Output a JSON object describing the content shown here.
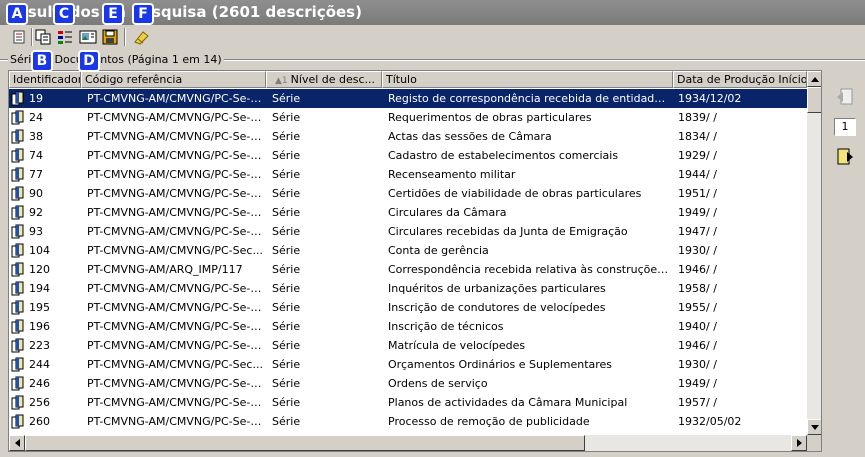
{
  "window": {
    "title": "Resultados da pesquisa (2601 descrições)"
  },
  "toolbar": {
    "markers": [
      "A",
      "B",
      "C",
      "D",
      "E",
      "F"
    ]
  },
  "group": {
    "label": "Séries / Documentos (Página 1 em 14)"
  },
  "table": {
    "columns": [
      "Identificador",
      "Código referência",
      "Nível de desc...",
      "Título",
      "Data de Produção Início"
    ],
    "sort_indicator": "▲1",
    "rows": [
      {
        "id": "19",
        "ref": "PT-CMVNG-AM/CMVNG/PC-Se-S...",
        "nivel": "Série",
        "titulo": "Registo de correspondência recebida de entidades parti...",
        "data": "1934/12/02"
      },
      {
        "id": "24",
        "ref": "PT-CMVNG-AM/CMVNG/PC-Se-S...",
        "nivel": "Série",
        "titulo": "Requerimentos de obras particulares",
        "data": "1839/  /"
      },
      {
        "id": "38",
        "ref": "PT-CMVNG-AM/CMVNG/PC-Se-S...",
        "nivel": "Série",
        "titulo": "Actas das sessões de Câmara",
        "data": "1834/  /"
      },
      {
        "id": "74",
        "ref": "PT-CMVNG-AM/CMVNG/PC-Se-S...",
        "nivel": "Série",
        "titulo": "Cadastro de estabelecimentos comerciais",
        "data": "1929/  /"
      },
      {
        "id": "77",
        "ref": "PT-CMVNG-AM/CMVNG/PC-Se-S...",
        "nivel": "Série",
        "titulo": "Recenseamento militar",
        "data": "1944/  /"
      },
      {
        "id": "90",
        "ref": "PT-CMVNG-AM/CMVNG/PC-Se-S...",
        "nivel": "Série",
        "titulo": "Certidões de viabilidade de obras particulares",
        "data": "1951/  /"
      },
      {
        "id": "92",
        "ref": "PT-CMVNG-AM/CMVNG/PC-Se-S...",
        "nivel": "Série",
        "titulo": "Circulares da Câmara",
        "data": "1949/  /"
      },
      {
        "id": "93",
        "ref": "PT-CMVNG-AM/CMVNG/PC-Se-S...",
        "nivel": "Série",
        "titulo": "Circulares recebidas da Junta de Emigração",
        "data": "1947/  /"
      },
      {
        "id": "104",
        "ref": "PT-CMVNG-AM/CMVNG/PC-Sec...",
        "nivel": "Série",
        "titulo": "Conta de gerência",
        "data": "1930/  /"
      },
      {
        "id": "120",
        "ref": "PT-CMVNG-AM/ARQ_IMP/117",
        "nivel": "Série",
        "titulo": "Correspondência recebida relativa às construções escol...",
        "data": "1946/  /"
      },
      {
        "id": "194",
        "ref": "PT-CMVNG-AM/CMVNG/PC-Se-S...",
        "nivel": "Série",
        "titulo": "Inquéritos de urbanizações particulares",
        "data": "1958/  /"
      },
      {
        "id": "195",
        "ref": "PT-CMVNG-AM/CMVNG/PC-Se-S...",
        "nivel": "Série",
        "titulo": "Inscrição de condutores de velocípedes",
        "data": "1955/  /"
      },
      {
        "id": "196",
        "ref": "PT-CMVNG-AM/CMVNG/PC-Se-S...",
        "nivel": "Série",
        "titulo": "Inscrição de técnicos",
        "data": "1940/  /"
      },
      {
        "id": "223",
        "ref": "PT-CMVNG-AM/CMVNG/PC-Se-S...",
        "nivel": "Série",
        "titulo": "Matrícula de velocípedes",
        "data": "1946/  /"
      },
      {
        "id": "244",
        "ref": "PT-CMVNG-AM/CMVNG/PC-Sec...",
        "nivel": "Série",
        "titulo": "Orçamentos Ordinários e Suplementares",
        "data": "1930/  /"
      },
      {
        "id": "246",
        "ref": "PT-CMVNG-AM/CMVNG/PC-Se-S...",
        "nivel": "Série",
        "titulo": "Ordens de serviço",
        "data": "1949/  /"
      },
      {
        "id": "256",
        "ref": "PT-CMVNG-AM/CMVNG/PC-Se-S...",
        "nivel": "Série",
        "titulo": "Planos de actividades da Câmara Municipal",
        "data": "1957/  /"
      },
      {
        "id": "260",
        "ref": "PT-CMVNG-AM/CMVNG/PC-Se-S...",
        "nivel": "Série",
        "titulo": "Processo de remoção de publicidade",
        "data": "1932/05/02"
      }
    ]
  },
  "pager": {
    "page": "1"
  },
  "colors": {
    "selection": "#0a246a",
    "marker": "#1a37e8",
    "face": "#d4d0c8"
  }
}
